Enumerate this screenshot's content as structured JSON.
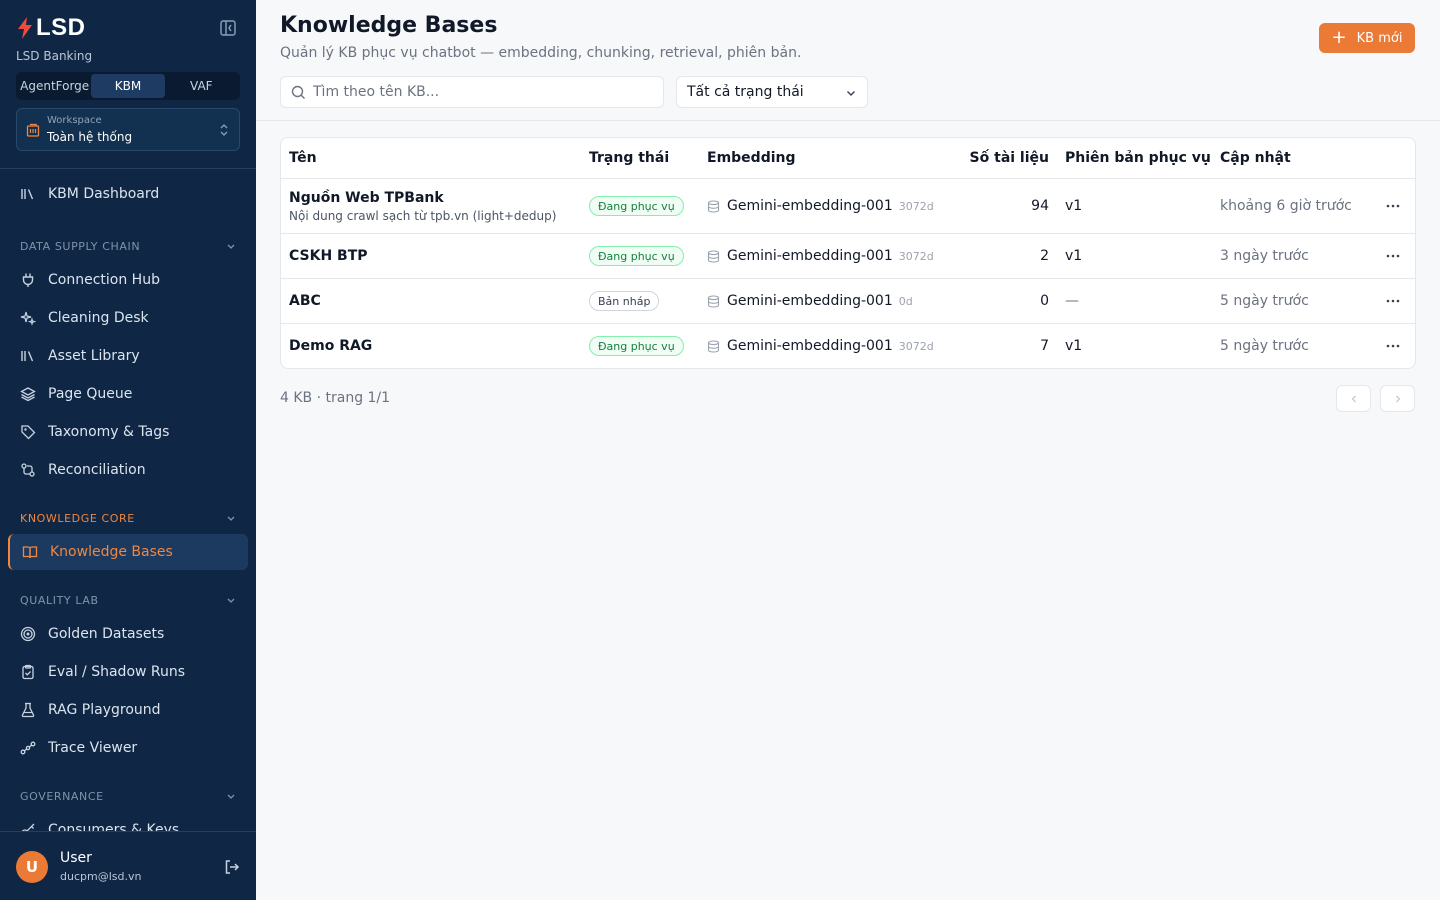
{
  "sidebar": {
    "brand": "LSD",
    "org": "LSD Banking",
    "tabs": [
      {
        "label": "AgentForge"
      },
      {
        "label": "KBM"
      },
      {
        "label": "VAF"
      }
    ],
    "workspace": {
      "label": "Workspace",
      "value": "Toàn hệ thống"
    },
    "dashboard": "KBM Dashboard",
    "sections": {
      "supply": "DATA SUPPLY CHAIN",
      "core": "KNOWLEDGE CORE",
      "quality": "QUALITY LAB",
      "governance": "GOVERNANCE"
    },
    "items": {
      "connection_hub": "Connection Hub",
      "cleaning_desk": "Cleaning Desk",
      "asset_library": "Asset Library",
      "page_queue": "Page Queue",
      "taxonomy": "Taxonomy & Tags",
      "reconciliation": "Reconciliation",
      "knowledge_bases": "Knowledge Bases",
      "golden": "Golden Datasets",
      "eval": "Eval / Shadow Runs",
      "rag": "RAG Playground",
      "trace": "Trace Viewer",
      "consumers": "Consumers & Keys"
    },
    "user": {
      "initial": "U",
      "name": "User",
      "email": "ducpm@lsd.vn"
    }
  },
  "header": {
    "title": "Knowledge Bases",
    "subtitle": "Quản lý KB phục vụ chatbot — embedding, chunking, retrieval, phiên bản.",
    "new_button": "KB mới"
  },
  "filters": {
    "search_placeholder": "Tìm theo tên KB...",
    "status_value": "Tất cả trạng thái"
  },
  "table": {
    "columns": {
      "name": "Tên",
      "status": "Trạng thái",
      "embedding": "Embedding",
      "docs": "Số tài liệu",
      "version": "Phiên bản phục vụ",
      "updated": "Cập nhật"
    },
    "rows": [
      {
        "name": "Nguồn Web TPBank",
        "desc": "Nội dung crawl sạch từ tpb.vn (light+dedup)",
        "status": "Đang phục vụ",
        "model": "Gemini-embedding-001",
        "dim": "3072d",
        "docs": "94",
        "version": "v1",
        "updated": "khoảng 6 giờ trước"
      },
      {
        "name": "CSKH BTP",
        "desc": "",
        "status": "Đang phục vụ",
        "model": "Gemini-embedding-001",
        "dim": "3072d",
        "docs": "2",
        "version": "v1",
        "updated": "3 ngày trước"
      },
      {
        "name": "ABC",
        "desc": "",
        "status": "Bản nháp",
        "model": "Gemini-embedding-001",
        "dim": "0d",
        "docs": "0",
        "version": "—",
        "updated": "5 ngày trước"
      },
      {
        "name": "Demo RAG",
        "desc": "",
        "status": "Đang phục vụ",
        "model": "Gemini-embedding-001",
        "dim": "3072d",
        "docs": "7",
        "version": "v1",
        "updated": "5 ngày trước"
      }
    ]
  },
  "pagination": {
    "summary": "4 KB · trang 1/1"
  },
  "colors": {
    "accent": "#ea7a35",
    "sidebar_bg": "#0f2744",
    "serving_badge": "#15803d"
  }
}
